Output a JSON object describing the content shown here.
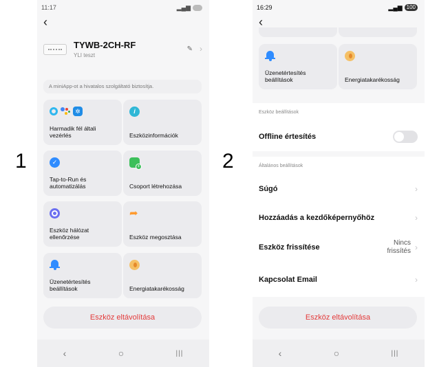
{
  "markers": {
    "one": "1",
    "two": "2"
  },
  "screen1": {
    "status": {
      "time": "11:17"
    },
    "device": {
      "name": "TYWB-2CH-RF",
      "owner": "YLI teszt"
    },
    "banner": "A miniApp-ot a hivatalos szolgáltató biztosítja.",
    "tiles": [
      {
        "label": "Harmadik fél általi vezérlés"
      },
      {
        "label": "Eszközinformációk"
      },
      {
        "label": "Tap-to-Run és automatizálás"
      },
      {
        "label": "Csoport létrehozása"
      },
      {
        "label": "Eszköz hálózat ellenőrzése"
      },
      {
        "label": "Eszköz megosztása"
      },
      {
        "label": "Üzenetértesítés beállítások"
      },
      {
        "label": "Energiatakarékosság"
      }
    ],
    "remove": "Eszköz eltávolítása"
  },
  "screen2": {
    "status": {
      "time": "16:29",
      "battery": "100"
    },
    "tiles": [
      {
        "label": "Üzenetértesítés beállítások"
      },
      {
        "label": "Energiatakarékosság"
      }
    ],
    "sections": {
      "device": "Eszköz beállítások",
      "general": "Általános beállítások"
    },
    "offline": "Offline értesítés",
    "rows": [
      {
        "label": "Súgó"
      },
      {
        "label": "Hozzáadás a kezdőképernyőhöz"
      },
      {
        "label": "Eszköz frissítése",
        "value": "Nincs frissítés"
      },
      {
        "label": "Kapcsolat Email"
      }
    ],
    "remove": "Eszköz eltávolítása"
  },
  "nav": {
    "back": "‹",
    "home": "○",
    "recents": "|||"
  },
  "colors": {
    "danger": "#e33a3a",
    "blue": "#2f8cff",
    "green": "#3cbf5a",
    "orange": "#ff9a2e"
  }
}
